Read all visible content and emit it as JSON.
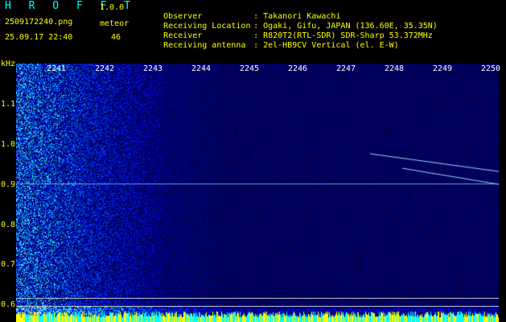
{
  "app": {
    "name": "H R O F F T",
    "version": "1.0.0"
  },
  "file": {
    "name": "2509172240.png",
    "timestamp": "25.09.17 22:40"
  },
  "meteor": {
    "label": "meteor",
    "count": "46"
  },
  "info": [
    {
      "key": "Observer",
      "value": "Takanori Kawachi"
    },
    {
      "key": "Receiving Location",
      "value": "Ogaki, Gifu, JAPAN (136.60E, 35.35N)"
    },
    {
      "key": "Receiver",
      "value": "R820T2(RTL-SDR) SDR-Sharp 53.372MHz"
    },
    {
      "key": "Receiving antenna",
      "value": "2el-HB9CV Vertical (el. E-W)"
    }
  ],
  "axes": {
    "y_unit": "kHz",
    "y_ticks": [
      "1.1",
      "1.0",
      "0.9",
      "0.8",
      "0.7",
      "0.6"
    ],
    "x_ticks": [
      "2241",
      "2242",
      "2243",
      "2244",
      "2245",
      "2246",
      "2247",
      "2248",
      "2249",
      "2250"
    ]
  },
  "colors": {
    "text": "#ffff00",
    "brand": "#00ffff",
    "bg": "#000000",
    "waterfall_dark": "#000080"
  }
}
